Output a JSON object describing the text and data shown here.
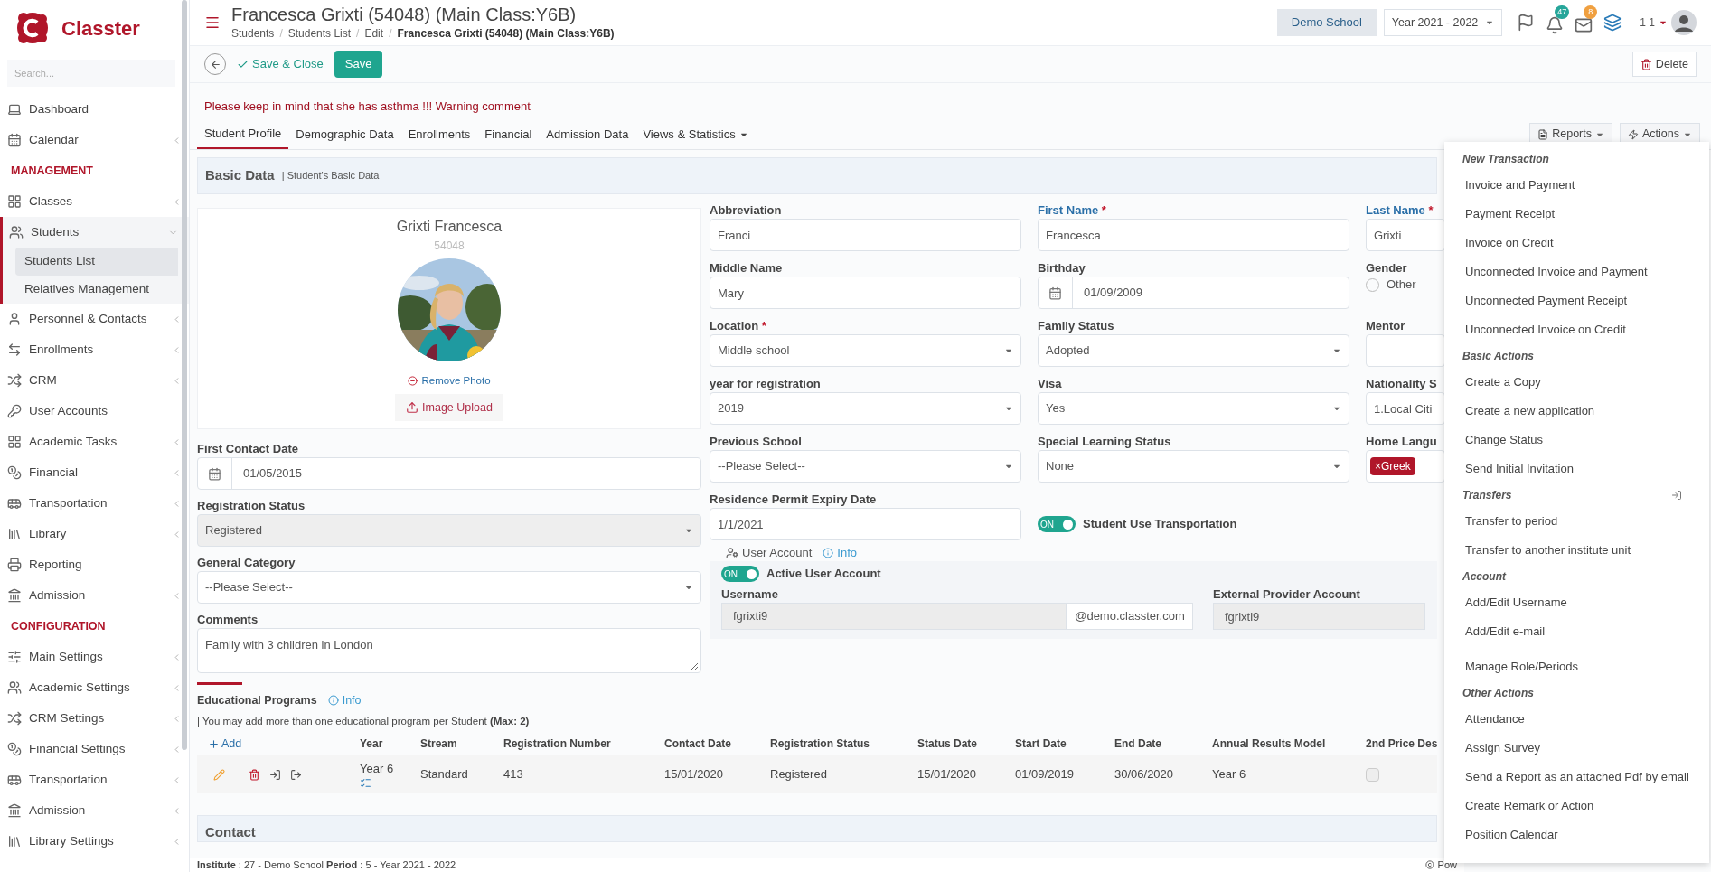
{
  "sidebar": {
    "logo": "Classter",
    "search": {
      "placeholder": "Search..."
    },
    "sections": [
      {
        "items": [
          {
            "label": "Dashboard",
            "expandable": false,
            "expanded": false,
            "selected": false
          },
          {
            "label": "Calendar",
            "expandable": true,
            "expanded": false,
            "selected": false
          }
        ]
      },
      {
        "title": "MANAGEMENT",
        "items": [
          {
            "label": "Classes",
            "expandable": true,
            "expanded": false,
            "selected": false
          },
          {
            "label": "Students",
            "expandable": true,
            "expanded": true,
            "selected": true,
            "children": [
              {
                "label": "Students List",
                "selected": true
              },
              {
                "label": "Relatives Management",
                "selected": false
              }
            ]
          },
          {
            "label": "Personnel & Contacts",
            "expandable": true,
            "expanded": false,
            "selected": false
          },
          {
            "label": "Enrollments",
            "expandable": true,
            "expanded": false,
            "selected": false
          },
          {
            "label": "CRM",
            "expandable": true,
            "expanded": false,
            "selected": false
          },
          {
            "label": "User Accounts",
            "expandable": false,
            "expanded": false,
            "selected": false
          },
          {
            "label": "Academic Tasks",
            "expandable": true,
            "expanded": false,
            "selected": false
          },
          {
            "label": "Financial",
            "expandable": true,
            "expanded": false,
            "selected": false
          },
          {
            "label": "Transportation",
            "expandable": true,
            "expanded": false,
            "selected": false
          },
          {
            "label": "Library",
            "expandable": true,
            "expanded": false,
            "selected": false
          },
          {
            "label": "Reporting",
            "expandable": false,
            "expanded": false,
            "selected": false
          },
          {
            "label": "Admission",
            "expandable": true,
            "expanded": false,
            "selected": false
          }
        ]
      },
      {
        "title": "CONFIGURATION",
        "items": [
          {
            "label": "Main Settings",
            "expandable": true,
            "expanded": false,
            "selected": false
          },
          {
            "label": "Academic Settings",
            "expandable": true,
            "expanded": false,
            "selected": false
          },
          {
            "label": "CRM Settings",
            "expandable": true,
            "expanded": false,
            "selected": false
          },
          {
            "label": "Financial Settings",
            "expandable": true,
            "expanded": false,
            "selected": false
          },
          {
            "label": "Transportation",
            "expandable": true,
            "expanded": false,
            "selected": false
          },
          {
            "label": "Admission",
            "expandable": true,
            "expanded": false,
            "selected": false
          },
          {
            "label": "Library Settings",
            "expandable": true,
            "expanded": false,
            "selected": false
          }
        ]
      }
    ]
  },
  "header": {
    "title": "Francesca Grixti (54048) (Main Class:Y6B)",
    "breadcrumb_separator": "/",
    "breadcrumb": [
      {
        "label": "Students",
        "current": false
      },
      {
        "label": "Students List",
        "current": false
      },
      {
        "label": "Edit",
        "current": false
      },
      {
        "label": "Francesca Grixti (54048) (Main Class:Y6B)",
        "current": true
      }
    ],
    "school": "Demo School",
    "year": "Year 2021 - 2022",
    "notifications": [
      {
        "count": "47",
        "color": "#26a69a"
      },
      {
        "count": "8",
        "color": "#f0a040"
      }
    ],
    "user": "1 1"
  },
  "toolbar": {
    "save_close": "Save & Close",
    "save": "Save",
    "delete": "Delete"
  },
  "warning": "Please keep in mind that she has asthma !!! Warning comment",
  "tabs": [
    {
      "label": "Student Profile",
      "selected": true,
      "has_menu": false
    },
    {
      "label": "Demographic Data",
      "selected": false,
      "has_menu": false
    },
    {
      "label": "Enrollments",
      "selected": false,
      "has_menu": false
    },
    {
      "label": "Financial",
      "selected": false,
      "has_menu": false
    },
    {
      "label": "Admission Data",
      "selected": false,
      "has_menu": false
    },
    {
      "label": "Views & Statistics",
      "selected": false,
      "has_menu": true
    }
  ],
  "tab_buttons": {
    "reports": "Reports",
    "actions": "Actions"
  },
  "basic_data": {
    "title": "Basic Data",
    "subtitle": "| Student's Basic Data",
    "profile": {
      "name": "Grixti Francesca",
      "code": "54048",
      "remove": "Remove Photo",
      "upload": "Image Upload"
    },
    "left_fields": [
      {
        "label": "First Contact Date",
        "kind": "date",
        "value": "01/05/2015",
        "disabled": false
      },
      {
        "label": "Registration Status",
        "kind": "select",
        "value": "Registered",
        "disabled": true
      },
      {
        "label": "General Category",
        "kind": "select",
        "value": "--Please Select--",
        "disabled": false
      },
      {
        "label": "Comments",
        "kind": "textarea",
        "value": "Family with 3 children in London",
        "disabled": false
      }
    ],
    "columns": [
      [
        {
          "label": "Abbreviation",
          "highlighted": false,
          "kind": "text",
          "value": "Franci"
        },
        {
          "label": "Middle Name",
          "highlighted": false,
          "kind": "text",
          "value": "Mary"
        },
        {
          "label": "Location",
          "mark": "*",
          "highlighted": false,
          "kind": "select",
          "value": "Middle school"
        },
        {
          "label": "year for registration",
          "highlighted": false,
          "kind": "select",
          "value": "2019"
        },
        {
          "label": "Previous School",
          "highlighted": false,
          "kind": "select",
          "value": "--Please Select--"
        },
        {
          "label": "Residence Permit Expiry Date",
          "highlighted": false,
          "kind": "text",
          "value": "1/1/2021"
        }
      ],
      [
        {
          "label": "First Name",
          "mark": "*",
          "highlighted": true,
          "kind": "text",
          "value": "Francesca"
        },
        {
          "label": "Birthday",
          "highlighted": false,
          "kind": "date",
          "value": "01/09/2009"
        },
        {
          "label": "Family Status",
          "highlighted": false,
          "kind": "select",
          "value": "Adopted"
        },
        {
          "label": "Visa",
          "highlighted": false,
          "kind": "select",
          "value": "Yes"
        },
        {
          "label": "Special Learning Status",
          "highlighted": false,
          "kind": "select",
          "value": "None"
        },
        {
          "kind": "toggle",
          "label": "Student Use Transportation",
          "on": true,
          "state_text": "ON"
        }
      ],
      [
        {
          "label": "Last Name",
          "mark": "*",
          "highlighted": true,
          "kind": "text",
          "value": "Grixti"
        },
        {
          "label": "Gender",
          "highlighted": false,
          "kind": "radio",
          "options": [
            {
              "label": "Other",
              "selected": false
            }
          ]
        },
        {
          "label": "Mentor",
          "highlighted": false,
          "kind": "text"
        },
        {
          "label": "Nationality S",
          "highlighted": false,
          "kind": "text",
          "value": "1.Local Citi"
        },
        {
          "label": "Home Langu",
          "highlighted": false,
          "kind": "tags",
          "tags": [
            {
              "label": "Greek",
              "remove": "×"
            }
          ]
        }
      ]
    ],
    "user_account": {
      "title": "User Account",
      "info": "Info",
      "toggle": {
        "label": "Active User Account",
        "on": true,
        "state_text": "ON"
      },
      "username_label": "Username",
      "username": "fgrixti9",
      "domain": "@demo.classter.com",
      "external_label": "External Provider Account",
      "external": "fgrixti9"
    }
  },
  "programs": {
    "title": "Educational Programs",
    "info": "Info",
    "note": "| You may add more than one educational program per Student **(Max: 2)**",
    "add": "Add",
    "columns": [
      "Year",
      "Stream",
      "Registration Number",
      "Contact Date",
      "Registration Status",
      "Status Date",
      "Start Date",
      "End Date",
      "Annual Results Model",
      "2nd Price Des"
    ],
    "rows": [
      {
        "cells": [
          "Year 6",
          "Standard",
          "413",
          "15/01/2020",
          "Registered",
          "15/01/2020",
          "01/09/2019",
          "30/06/2020",
          "Year 6"
        ],
        "checked": false
      }
    ]
  },
  "contact": {
    "title": "Contact"
  },
  "footer": {
    "info": "**Institute** : 27 - Demo School **Period** : 5 - Year 2021 - 2022",
    "powered": "Pow"
  },
  "actions_menu": [
    {
      "title": "New Transaction",
      "items": [
        "Invoice and Payment",
        "Payment Receipt",
        "Invoice on Credit",
        "Unconnected Invoice and Payment",
        "Unconnected Payment Receipt",
        "Unconnected Invoice on Credit"
      ]
    },
    {
      "title": "Basic Actions",
      "items": [
        "Create a Copy",
        "Create a new application",
        "Change Status",
        "Send Initial Invitation"
      ]
    },
    {
      "title": "Transfers",
      "items": [
        "Transfer to period",
        "Transfer to another institute unit"
      ]
    },
    {
      "title": "Account",
      "items": [
        "Add/Edit Username",
        "Add/Edit e-mail",
        "Manage Role/Periods"
      ]
    },
    {
      "title": "Other Actions",
      "items": [
        "Attendance",
        "Assign Survey",
        "Send a Report as an attached Pdf by email",
        "Create Remark or Action",
        "Position Calendar"
      ]
    }
  ]
}
